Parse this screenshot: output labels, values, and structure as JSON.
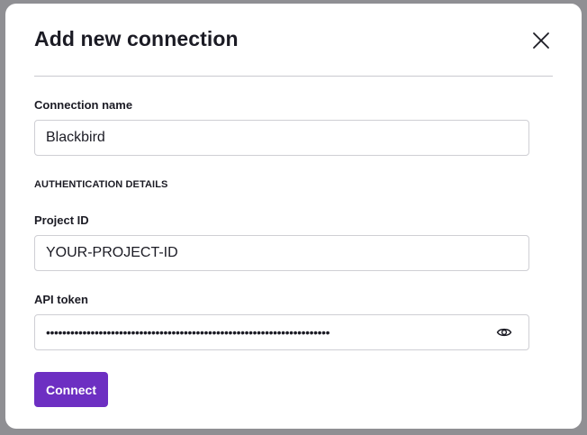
{
  "dialog": {
    "title": "Add new connection"
  },
  "connection_name": {
    "label": "Connection name",
    "value": "Blackbird"
  },
  "section_heading": "AUTHENTICATION DETAILS",
  "project_id": {
    "label": "Project ID",
    "value": "YOUR-PROJECT-ID"
  },
  "api_token": {
    "label": "API token",
    "masked_value": "••••••••••••••••••••••••••••••••••••••••••••••••••••••••••••••••••••••",
    "visibility_icon": "eye-icon"
  },
  "actions": {
    "connect_label": "Connect"
  },
  "colors": {
    "accent": "#6d2fc2",
    "backdrop": "#8f8f93",
    "text": "#1b1b24"
  }
}
